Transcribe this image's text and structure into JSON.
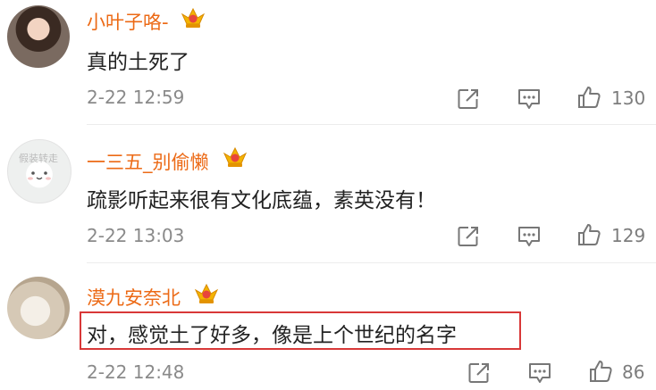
{
  "comments": [
    {
      "username": "小叶子咯-",
      "text": "真的土死了",
      "time": "2-22 12:59",
      "likes": "130"
    },
    {
      "username": "一三五_别偷懒",
      "text": "疏影听起来很有文化底蕴，素英没有！",
      "time": "2-22 13:03",
      "likes": "129",
      "avatar_text": "假装转走"
    },
    {
      "username": "漠九安奈北",
      "text": "对，感觉土了好多，像是上个世纪的名字",
      "time": "2-22 12:48",
      "likes": "86"
    }
  ],
  "colors": {
    "username": "#ec6a16",
    "highlight_border": "#d83838",
    "meta": "#8a8a8a"
  }
}
